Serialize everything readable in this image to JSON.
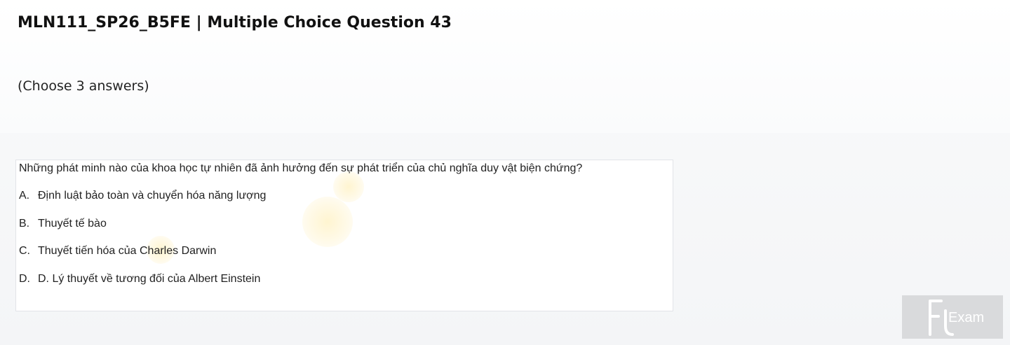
{
  "page": {
    "title": "MLN111_SP26_B5FE | Multiple Choice Question 43",
    "instruction": "(Choose 3 answers)"
  },
  "question": {
    "text": "Những phát minh nào của khoa học tự nhiên đã ảnh hưởng đến sự phát triển của chủ nghĩa duy vật biện chứng?",
    "options": [
      {
        "letter": "A.",
        "text": "Định luật bảo toàn và chuyển hóa năng lượng"
      },
      {
        "letter": "B.",
        "text": "Thuyết tế bào"
      },
      {
        "letter": "C.",
        "text": "Thuyết tiến hóa của Charles Darwin"
      },
      {
        "letter": "D.",
        "text": "D. Lý thuyết về tương đối của Albert Einstein"
      }
    ]
  },
  "logo": {
    "text": "Exam",
    "name": "fu-exam-logo"
  }
}
